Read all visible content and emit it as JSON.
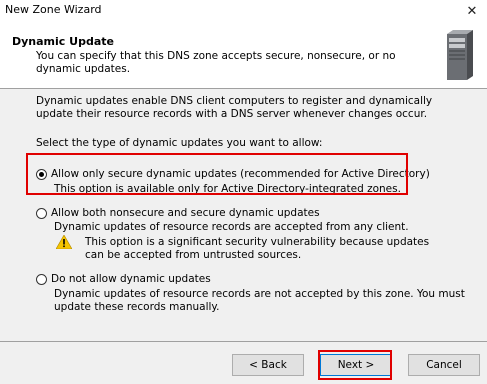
{
  "window": {
    "title": "New Zone Wizard"
  },
  "header": {
    "title": "Dynamic Update",
    "subtitle": "You can specify that this DNS zone accepts secure, nonsecure, or no dynamic updates."
  },
  "body": {
    "intro": "Dynamic updates enable DNS client computers to register and dynamically update their resource records with a DNS server whenever changes occur.",
    "select_label": "Select the type of dynamic updates you want to allow:",
    "options": [
      {
        "label": "Allow only secure dynamic updates (recommended for Active Directory)",
        "description": "This option is available only for Active Directory-integrated zones.",
        "selected": true
      },
      {
        "label": "Allow both nonsecure and secure dynamic updates",
        "description": "Dynamic updates of resource records are accepted from any client.",
        "warning": "This option is a significant security vulnerability because updates can be accepted from untrusted sources.",
        "selected": false
      },
      {
        "label": "Do not allow dynamic updates",
        "description": "Dynamic updates of resource records are not accepted by this zone. You must update these records manually.",
        "selected": false
      }
    ]
  },
  "footer": {
    "back_label": "< Back",
    "next_label": "Next >",
    "cancel_label": "Cancel"
  },
  "colors": {
    "highlight": "#e00000",
    "warning": "#f5c400"
  },
  "icons": {
    "close": "close-icon",
    "server": "server-icon",
    "warning": "warning-icon"
  }
}
